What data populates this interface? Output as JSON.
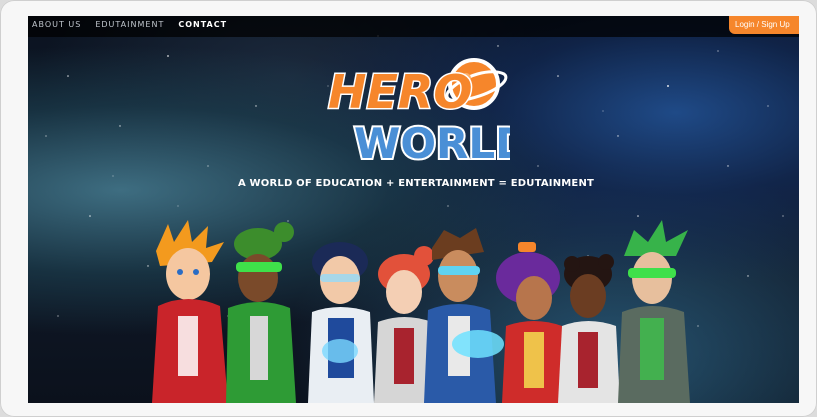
{
  "nav": {
    "items": [
      {
        "label": "ABOUT US",
        "active": false
      },
      {
        "label": "EDUTAINMENT",
        "active": false
      },
      {
        "label": "CONTACT",
        "active": true
      }
    ],
    "login_label": "Login / Sign Up"
  },
  "hero": {
    "logo_word_top": "HERO",
    "logo_word_bottom": "WORLD",
    "tagline": "A WORLD OF EDUCATION + ENTERTAINMENT = EDUTAINMENT"
  },
  "colors": {
    "accent_orange": "#f6862b",
    "logo_blue": "#4a8fd6",
    "nav_bg": "#000000"
  },
  "icons": [
    "hero-world-logo-planet-icon"
  ]
}
